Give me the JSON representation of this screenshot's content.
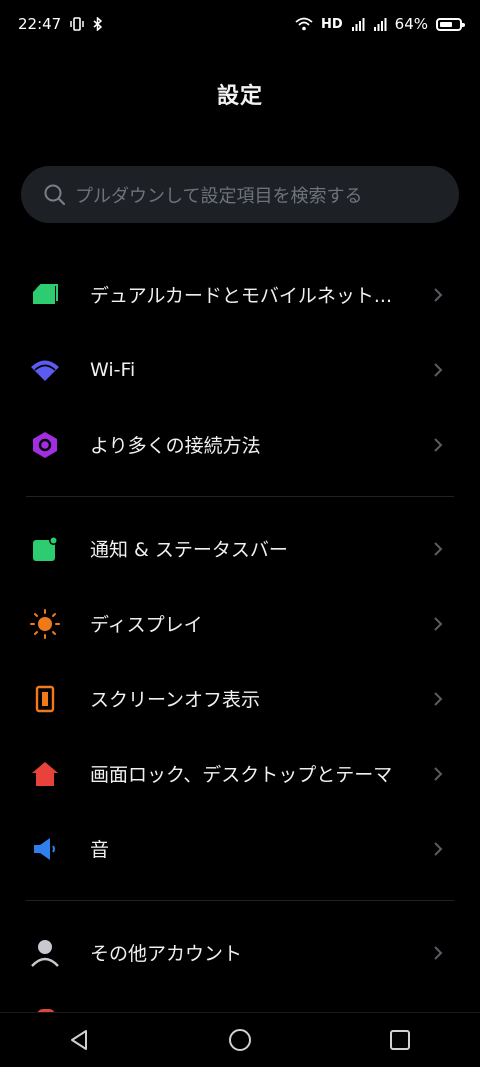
{
  "status_bar": {
    "time": "22:47",
    "network_type": "HD",
    "battery_percent": "64%",
    "battery_level": 0.64
  },
  "header": {
    "title": "設定"
  },
  "search": {
    "placeholder": "プルダウンして設定項目を検索する"
  },
  "sections": [
    {
      "items": [
        {
          "label": "デュアルカードとモバイルネット...",
          "icon": "sim-card-icon",
          "color": "#2ecc71"
        },
        {
          "label": "Wi-Fi",
          "icon": "wifi-icon",
          "color": "#5b5bf0"
        },
        {
          "label": "より多くの接続方法",
          "icon": "connection-hex-icon",
          "color": "#a12ee0"
        }
      ]
    },
    {
      "items": [
        {
          "label": "通知 & ステータスバー",
          "icon": "notification-icon",
          "color": "#2ecc71"
        },
        {
          "label": "ディスプレイ",
          "icon": "brightness-icon",
          "color": "#f07a1a"
        },
        {
          "label": "スクリーンオフ表示",
          "icon": "screen-off-icon",
          "color": "#f07a1a"
        },
        {
          "label": "画面ロック、デスクトップとテーマ",
          "icon": "home-lock-icon",
          "color": "#e8423a"
        },
        {
          "label": "音",
          "icon": "speaker-icon",
          "color": "#2f80ed"
        }
      ]
    },
    {
      "items": [
        {
          "label": "その他アカウント",
          "icon": "account-icon",
          "color": "#c8c8d0"
        }
      ]
    }
  ],
  "nav": {
    "back": "back-icon",
    "home": "home-icon",
    "recents": "recents-icon"
  }
}
